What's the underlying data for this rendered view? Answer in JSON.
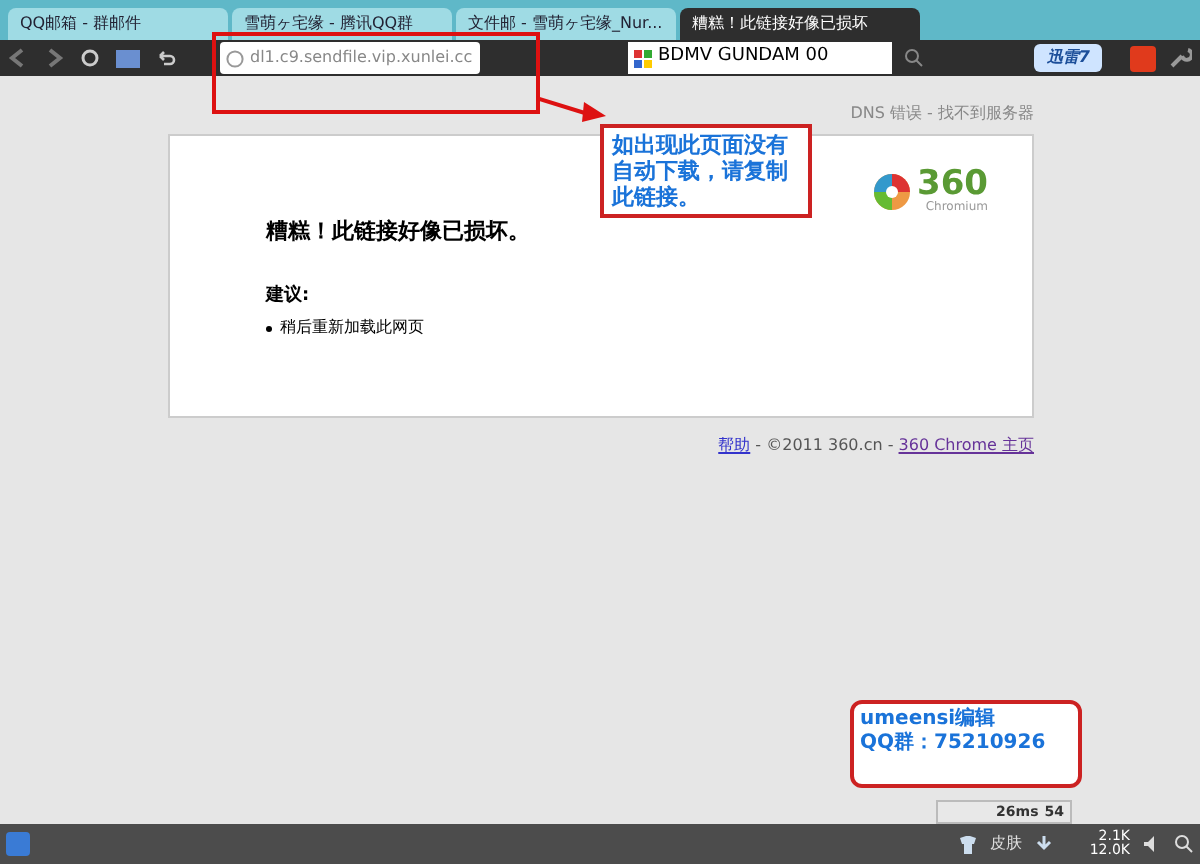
{
  "tabs": [
    {
      "label": "QQ邮箱 - 群邮件",
      "selected": false
    },
    {
      "label": "雪萌ヶ宅缘 - 腾讯QQ群",
      "selected": false
    },
    {
      "label": "文件邮 - 雪萌ヶ宅缘_Nur...",
      "selected": false
    },
    {
      "label": "糟糕！此链接好像已损坏",
      "selected": true
    }
  ],
  "address_bar": {
    "value": "dl1.c9.sendfile.vip.xunlei.cc"
  },
  "search_field": {
    "value": "BDMV GUNDAM 00"
  },
  "toolbar_badge": "迅雷7",
  "error_page": {
    "status": "DNS 错误 - 找不到服务器",
    "heading": "糟糕！此链接好像已损坏。",
    "suggestions_title": "建议:",
    "suggestions": [
      "稍后重新加载此网页"
    ],
    "logo_text": "360",
    "logo_subtext": "Chromium"
  },
  "footer": {
    "help_link": "帮助",
    "copyright": " - ©2011 360.cn - ",
    "home_link": "360 Chrome 主页"
  },
  "annotations": [
    {
      "kind": "callout",
      "text": "如出现此页面没有自动下载，请复制此链接。"
    },
    {
      "kind": "note",
      "lines": [
        "umeensi编辑",
        "QQ群：75210926"
      ]
    }
  ],
  "status_bar": {
    "skin_label": "皮肤",
    "ping": "26ms",
    "count": "54",
    "upload": "2.1K",
    "download": "12.0K"
  }
}
